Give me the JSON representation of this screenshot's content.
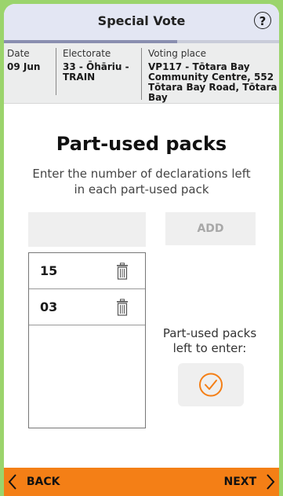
{
  "header": {
    "title": "Special Vote",
    "help_icon": "?"
  },
  "progress": {
    "fraction": 0.63
  },
  "info": {
    "date_label": "Date",
    "date_value": "09 Jun",
    "electorate_label": "Electorate",
    "electorate_value": "33 - Ōhāriu - TRAIN",
    "place_label": "Voting place",
    "place_value": "VP117 - Tōtara Bay Community Centre, 552 Tōtara Bay Road, Tōtara Bay"
  },
  "page": {
    "title": "Part-used packs",
    "instruction": "Enter the number of declarations left in each part-used pack"
  },
  "entry": {
    "input_value": "",
    "add_label": "ADD"
  },
  "packs": [
    {
      "value": "15"
    },
    {
      "value": "03"
    }
  ],
  "status": {
    "label": "Part-used packs left to enter:",
    "icon": "check-circle-icon"
  },
  "footer": {
    "back_label": "BACK",
    "next_label": "NEXT"
  },
  "colors": {
    "accent": "#f47f16",
    "frame": "#9bd46c",
    "header_bg": "#e3e6f3"
  }
}
